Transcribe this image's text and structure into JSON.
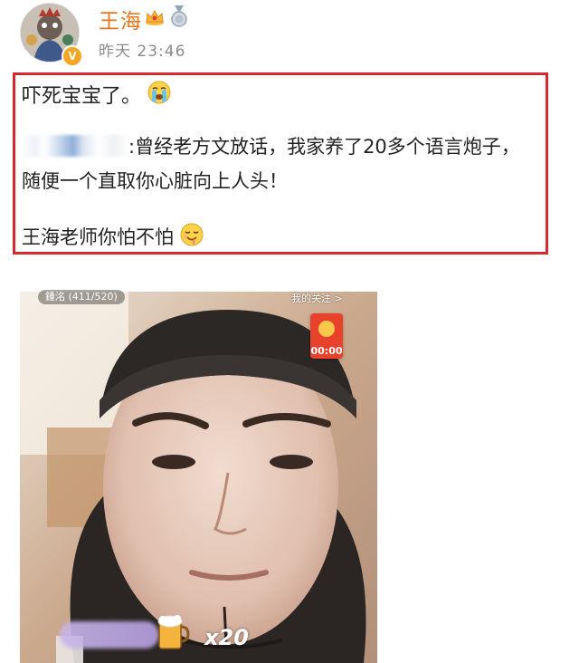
{
  "post": {
    "author": {
      "name": "王海",
      "avatar_icon": "avatar-illustration",
      "verified_badge": "V",
      "badges": [
        "crown-icon",
        "medal-icon"
      ]
    },
    "timestamp": "昨天 23:46",
    "text": {
      "line1": "吓死宝宝了。",
      "line2_mention": "",
      "line2": ":曾经老方文放话，我家养了20多个语言炮子，",
      "line3": "随便一个直取你心脏向上人头！",
      "line4": "王海老师你怕不怕"
    },
    "highlight_color": "#d4292f",
    "name_color": "#e8761f"
  },
  "livestream": {
    "viewer_info": "鍾洺 (411/520)",
    "follow_label": "我的关注 >",
    "red_packet_timer": "00:00",
    "gift_count": "x20"
  }
}
